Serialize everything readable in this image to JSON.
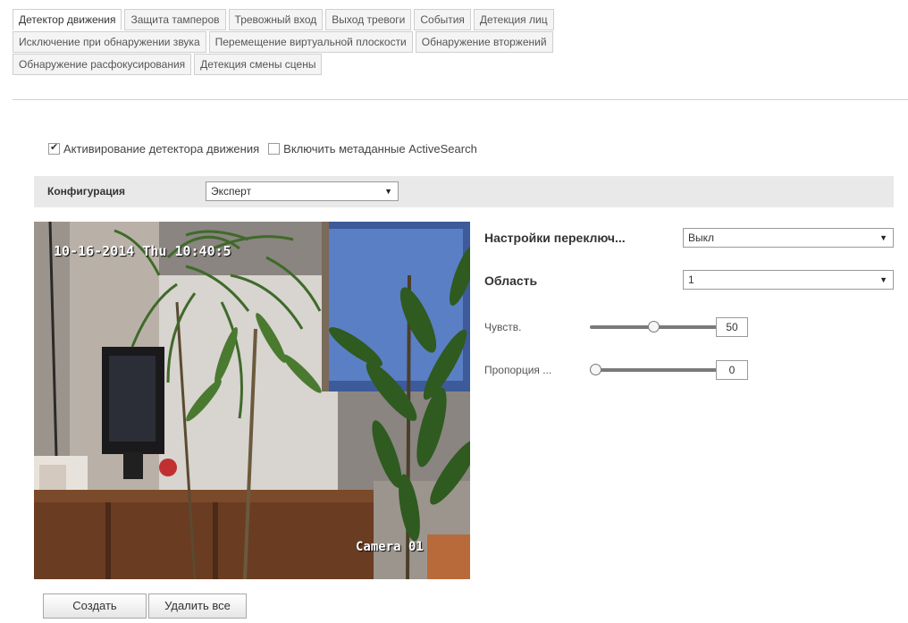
{
  "tabs": {
    "row1": [
      "Детектор движения",
      "Защита тамперов",
      "Тревожный вход",
      "Выход тревоги",
      "События",
      "Детекция лиц"
    ],
    "row2": [
      "Исключение при обнаружении звука",
      "Перемещение виртуальной плоскости",
      "Обнаружение вторжений"
    ],
    "row3": [
      "Обнаружение расфокусирования",
      "Детекция смены сцены"
    ],
    "active": "Детектор движения"
  },
  "checkboxes": {
    "enable_motion": {
      "label": "Активирование детектора движения",
      "checked": true
    },
    "activesearch": {
      "label": "Включить метаданные ActiveSearch",
      "checked": false
    }
  },
  "config": {
    "label": "Конфигурация",
    "value": "Эксперт"
  },
  "video": {
    "osd_date": "10-16-2014 Thu 10:40:5",
    "osd_camera": "Camera 01"
  },
  "settings": {
    "switch_label": "Настройки переключ...",
    "switch_value": "Выкл",
    "area_label": "Область",
    "area_value": "1",
    "sensitivity_label": "Чувств.",
    "sensitivity_value": "50",
    "sensitivity_fraction": 0.5,
    "proportion_label": "Пропорция ...",
    "proportion_value": "0",
    "proportion_fraction": 0.0
  },
  "buttons": {
    "create": "Создать",
    "delete_all": "Удалить все"
  },
  "icons": {
    "dropdown": "chevron-down-icon",
    "check": "checkbox-check-icon"
  }
}
